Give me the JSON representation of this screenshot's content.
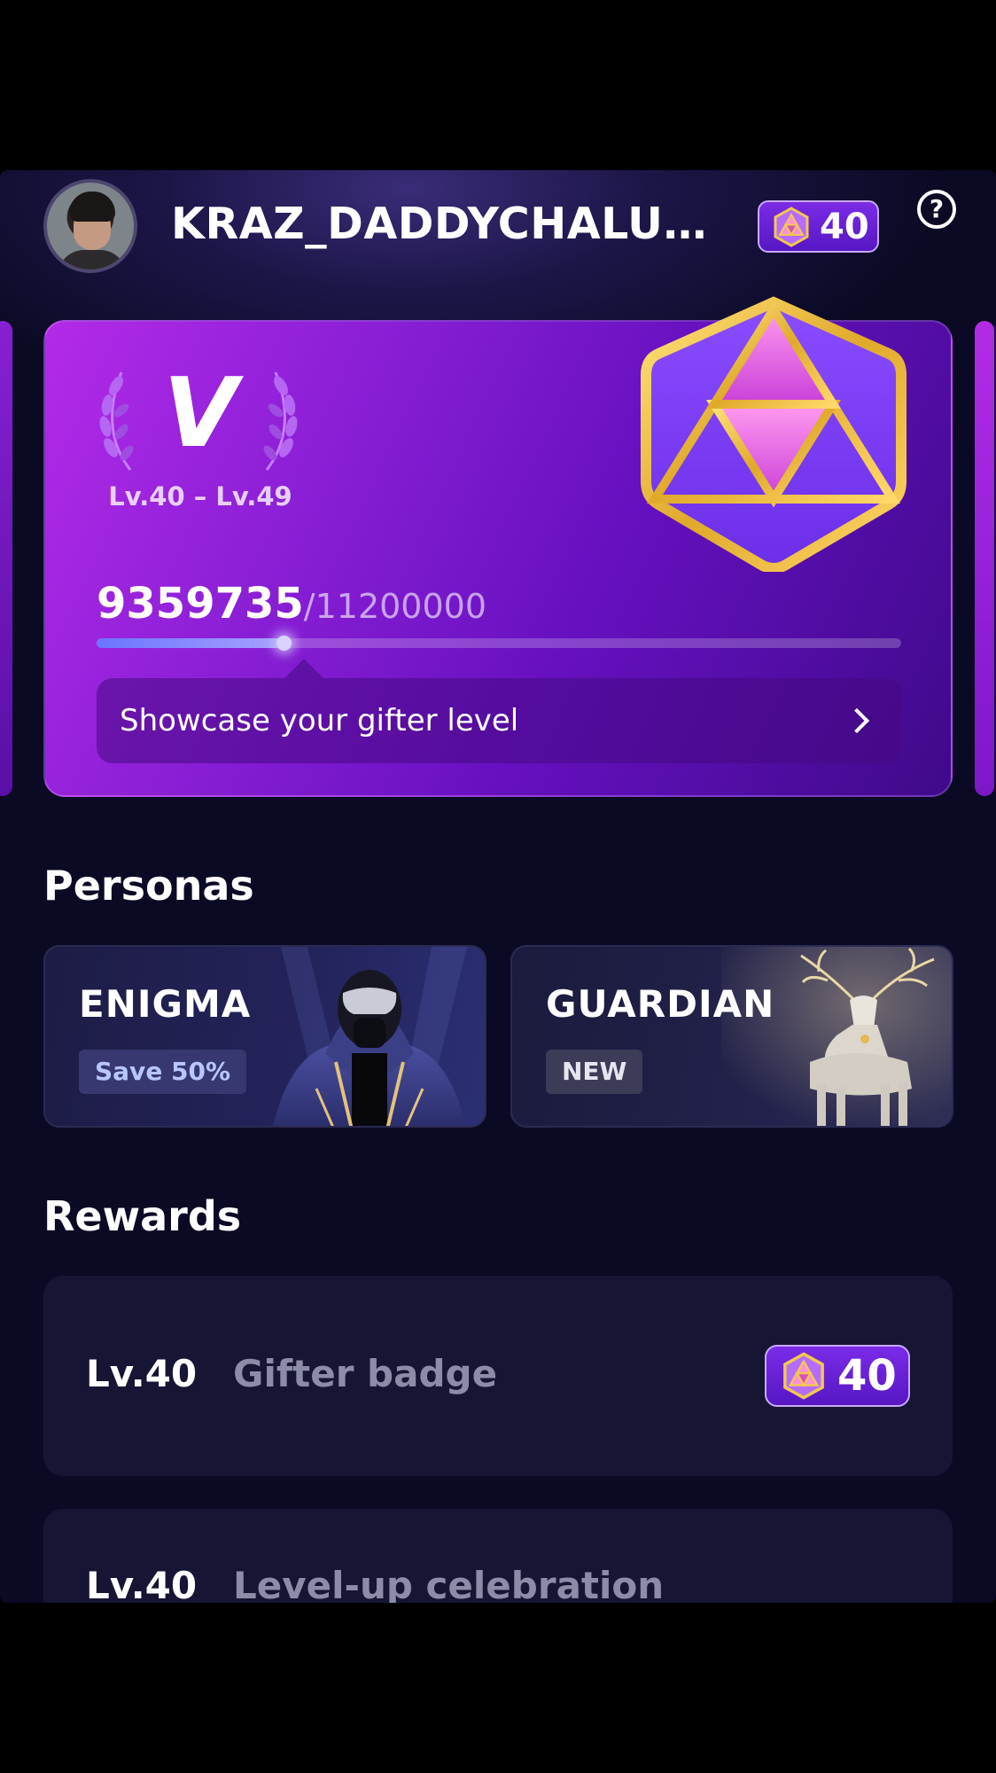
{
  "header": {
    "username": "KRAZ_DADDYCHALUP...",
    "level_badge": "40",
    "help_icon": "question-circle-icon"
  },
  "level_card": {
    "tier": "V",
    "range": "Lv.40 – Lv.49",
    "progress_current": "9359735",
    "progress_total": "/11200000",
    "progress_fraction": 0.236,
    "showcase_label": "Showcase your gifter level"
  },
  "personas": {
    "title": "Personas",
    "items": [
      {
        "name": "ENIGMA",
        "tag": "Save 50%"
      },
      {
        "name": "GUARDIAN",
        "tag": "NEW"
      }
    ]
  },
  "rewards": {
    "title": "Rewards",
    "items": [
      {
        "level": "Lv.40",
        "label": "Gifter badge",
        "badge": "40"
      },
      {
        "level": "Lv.40",
        "label": "Level-up celebration"
      }
    ]
  },
  "colors": {
    "background": "#0b0a24",
    "card_purple": "#8a1fd6",
    "gold": "#e9b83a",
    "badge_purple": "#6a22d8"
  }
}
